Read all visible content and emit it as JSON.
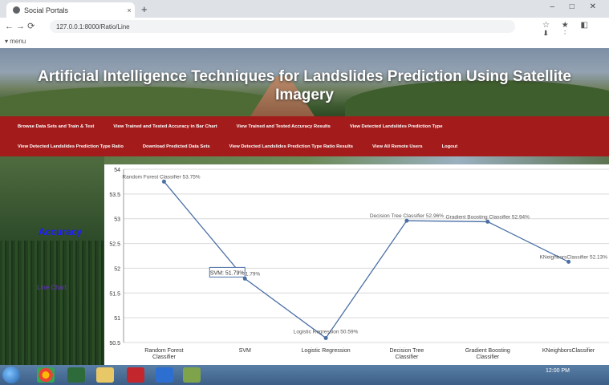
{
  "browser": {
    "tab_title": "Social Portals",
    "tab_close": "×",
    "new_tab": "+",
    "window_controls": "–  □  ✕",
    "nav_icons": "← → ⟳",
    "address": "127.0.0.1:8000/Ratio/Line",
    "toolbar_icons": "☆ ★ ◧ ⬇ ⋮",
    "bookmark": "▾ menu"
  },
  "page": {
    "title_line1": "Artificial Intelligence Techniques for Landslides Prediction Using Satellite",
    "title_line2": "Imagery",
    "nav_row1": [
      "Browse Data Sets and Train & Test",
      "View Trained and Tested Accuracy in Bar Chart",
      "View Trained and Tested Accuracy Results",
      "View Detected Landslides Prediction Type"
    ],
    "nav_row2": [
      "View Detected Landslides Prediction Type Ratio",
      "Download Predicted Data Sets",
      "View Detected Landslides Prediction Type Ratio Results",
      "View All Remote Users",
      "Logout"
    ],
    "side_link": "Accuracy",
    "side_text": "Line Chart"
  },
  "chart_data": {
    "type": "line",
    "categories": [
      "Random Forest Classifier",
      "SVM",
      "Logistic Regression",
      "Decision Tree Classifier",
      "Gradient Boosting Classifier",
      "KNeighborsClassifier"
    ],
    "values": [
      53.75,
      51.79,
      50.59,
      52.96,
      52.94,
      52.13
    ],
    "point_labels": [
      "Random Forest Classifier 53.75%",
      "SVM 51.79%",
      "Logistic Regression 50.59%",
      "Decision Tree Classifier 52.96%",
      "Gradient Boosting Classifier 52.94%",
      "KNeighborsClassifier 52.13%"
    ],
    "tooltip": "SVM: 51.79%",
    "yticks": [
      "50.5",
      "51",
      "51.5",
      "52",
      "52.5",
      "53",
      "53.5",
      "54"
    ],
    "ylim": [
      50.5,
      54
    ],
    "xlabel": "",
    "ylabel": "",
    "grid": true,
    "colors": {
      "line": "#4a6fa5",
      "grid": "#d9d9d9",
      "text": "#333333"
    }
  },
  "taskbar": {
    "clock": "12:00 PM"
  }
}
